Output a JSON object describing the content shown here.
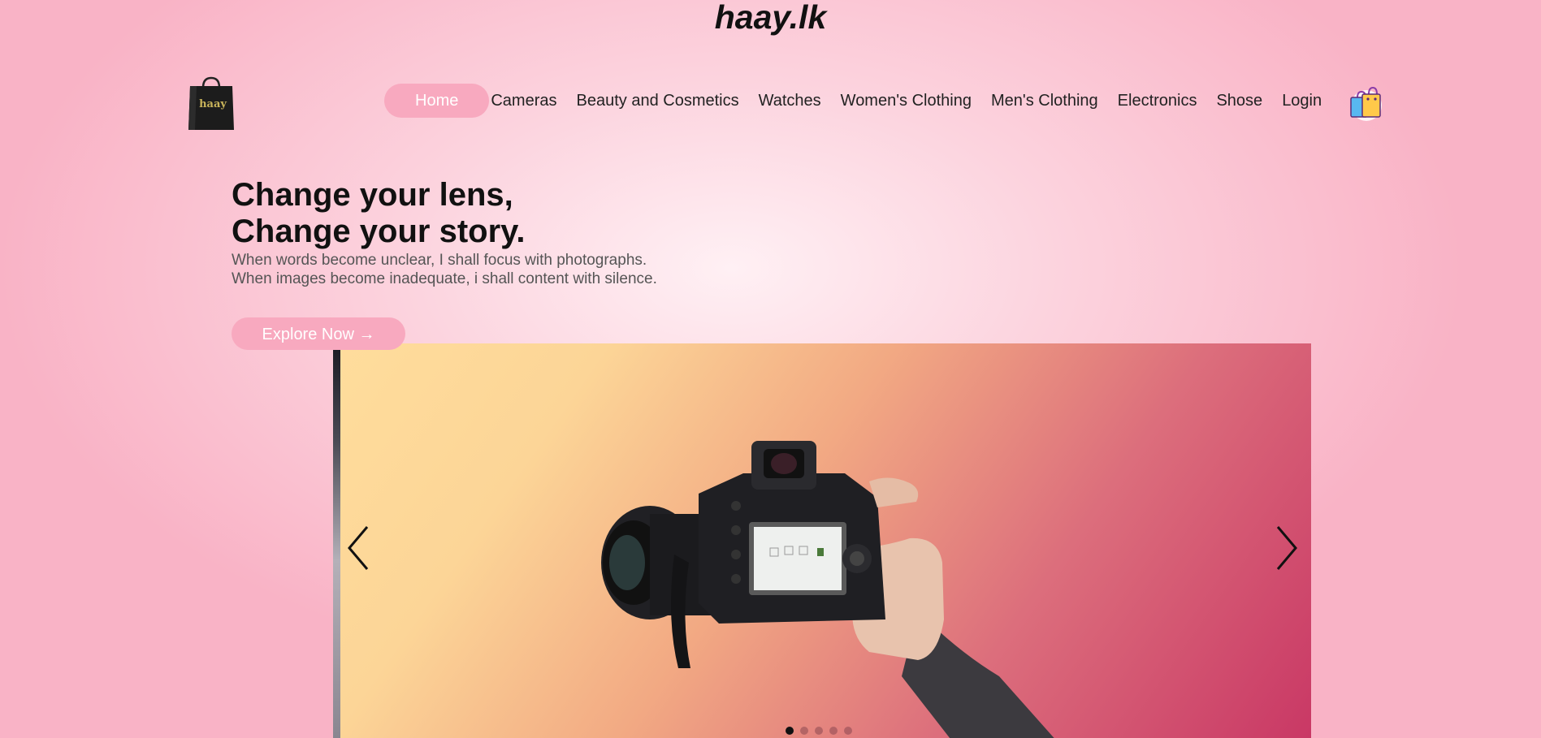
{
  "site": {
    "title": "haay.lk",
    "logo_text": "haay"
  },
  "nav": {
    "items": [
      {
        "label": "Home",
        "active": true
      },
      {
        "label": "Cameras",
        "active": false
      },
      {
        "label": "Beauty and Cosmetics",
        "active": false
      },
      {
        "label": "Watches",
        "active": false
      },
      {
        "label": "Women's Clothing",
        "active": false
      },
      {
        "label": "Men's Clothing",
        "active": false
      },
      {
        "label": "Electronics",
        "active": false
      },
      {
        "label": "Shose",
        "active": false
      },
      {
        "label": "Login",
        "active": false
      }
    ],
    "cart_icon": "shopping-bags-icon"
  },
  "hero": {
    "title_line1": "Change your lens,",
    "title_line2": "Change your story.",
    "sub_line1": "When words become unclear, I shall focus with photographs.",
    "sub_line2": "When images become inadequate, i shall content with silence.",
    "cta_label": "Explore Now →"
  },
  "carousel": {
    "prev_icon": "chevron-left-icon",
    "next_icon": "chevron-right-icon",
    "slide_count": 5,
    "active_slide": 1,
    "slide_image": "camera-in-hand-photo"
  },
  "colors": {
    "accent": "#f8a9bf",
    "text": "#222222"
  }
}
